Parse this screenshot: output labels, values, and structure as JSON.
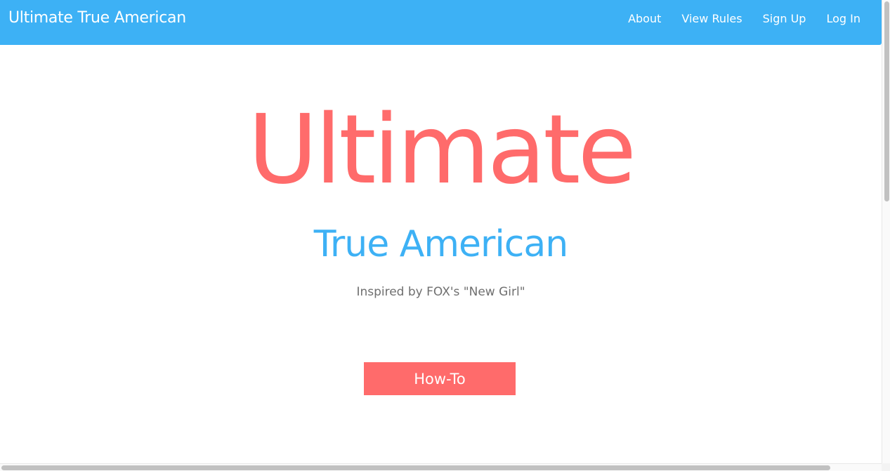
{
  "navbar": {
    "brand": "Ultimate True American",
    "links": [
      {
        "label": "About"
      },
      {
        "label": "View Rules"
      },
      {
        "label": "Sign Up"
      },
      {
        "label": "Log In"
      }
    ],
    "background_color": "#3db1f5"
  },
  "hero": {
    "title": "Ultimate",
    "subtitle": "True American",
    "tagline": "Inspired by FOX's \"New Girl\"",
    "button_label": "How-To",
    "title_color": "#ff6b6b",
    "subtitle_color": "#3db1f5",
    "button_color": "#ff6b6b"
  }
}
